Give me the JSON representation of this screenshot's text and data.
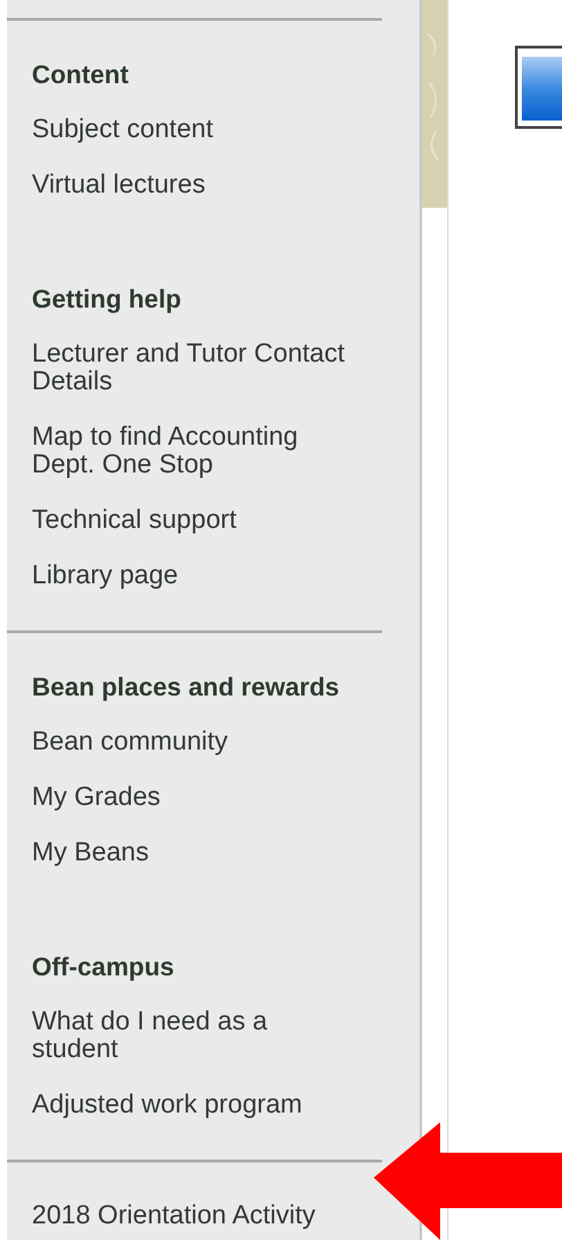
{
  "sidebar": {
    "items": [
      {
        "kind": "divider"
      },
      {
        "kind": "section",
        "heading": "Content",
        "links": [
          "Subject content",
          "Virtual lectures"
        ]
      },
      {
        "kind": "section",
        "heading": "Getting help",
        "links": [
          "Lecturer and Tutor Contact Details",
          "Map to find Accounting Dept. One Stop",
          "Technical support",
          "Library page"
        ]
      },
      {
        "kind": "divider"
      },
      {
        "kind": "section",
        "heading": "Bean places and rewards",
        "links": [
          "Bean community",
          "My Grades",
          "My Beans"
        ]
      },
      {
        "kind": "section",
        "heading": "Off-campus",
        "links": [
          "What do I need as a student",
          "Adjusted work program"
        ]
      },
      {
        "kind": "divider"
      },
      {
        "kind": "section",
        "links": [
          "2018 Orientation Activity"
        ]
      }
    ]
  }
}
